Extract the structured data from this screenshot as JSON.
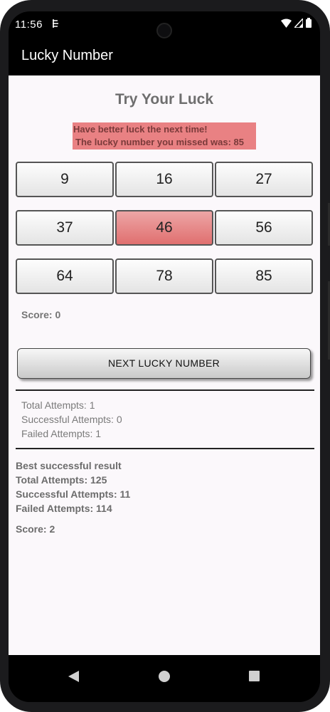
{
  "status_bar": {
    "time": "11:56"
  },
  "app_bar": {
    "title": "Lucky Number"
  },
  "main": {
    "heading": "Try Your Luck",
    "message_line1": "Have better luck the next time!",
    "message_line2": "The lucky number you missed was: 85",
    "numbers": [
      "9",
      "16",
      "27",
      "37",
      "46",
      "56",
      "64",
      "78",
      "85"
    ],
    "selected_number": "46",
    "score": "Score: 0",
    "next_button_label": "NEXT LUCKY NUMBER"
  },
  "current_stats": {
    "total": "Total Attempts: 1",
    "successful": "Successful Attempts: 0",
    "failed": "Failed Attempts:  1"
  },
  "best_stats": {
    "title": "Best successful result",
    "total": "Total Attempts: 125",
    "successful": "Successful Attempts: 11",
    "failed": "Failed Attempts:  114",
    "score": "Score: 2"
  },
  "colors": {
    "message_bg": "#e98183",
    "missed_button": "#e06f6f",
    "app_bar": "#000000"
  },
  "icons": {
    "notification": "sync-icon",
    "wifi": "wifi-icon",
    "signal": "signal-icon",
    "battery": "battery-icon",
    "nav_back": "back-icon",
    "nav_home": "home-icon",
    "nav_recent": "recents-icon"
  }
}
